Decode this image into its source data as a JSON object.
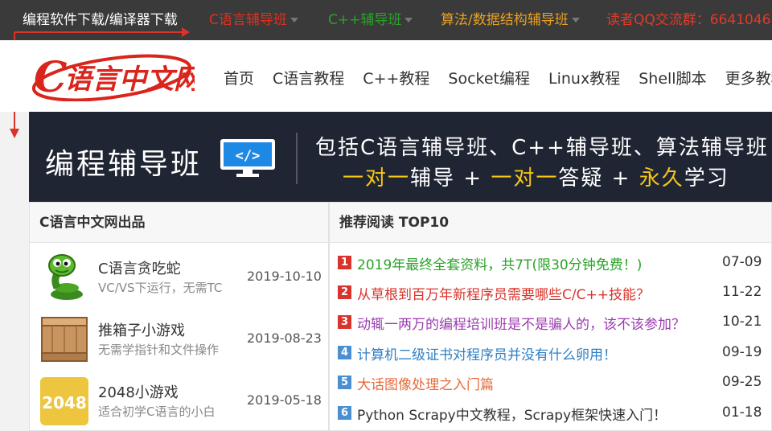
{
  "topbar": {
    "items": [
      {
        "label": "编程软件下载/编译器下载",
        "color": "#ffffff"
      },
      {
        "label": "C语言辅导班",
        "color": "#e0301e"
      },
      {
        "label": "C++辅导班",
        "color": "#2aa22a"
      },
      {
        "label": "算法/数据结构辅导班",
        "color": "#e8a020"
      },
      {
        "label": "读者QQ交流群：6641046",
        "color": "#e03a2a"
      }
    ]
  },
  "logo": {
    "text": "C语言中文网",
    "color": "#d9251c"
  },
  "nav": {
    "items": [
      "首页",
      "C语言教程",
      "C++教程",
      "Socket编程",
      "Linux教程",
      "Shell脚本",
      "更多教程»"
    ]
  },
  "banner": {
    "title": "编程辅导班",
    "icon_label": "</>",
    "line1": "包括C语言辅导班、C++辅导班、算法辅导班",
    "line2_parts": [
      "一对一",
      "辅导 + ",
      "一对一",
      "答疑 + ",
      "永久",
      "学习"
    ]
  },
  "left_panel": {
    "header": "C语言中文网出品",
    "items": [
      {
        "title": "C语言贪吃蛇",
        "desc": "VC/VS下运行，无需TC",
        "date": "2019-10-10",
        "icon": "snake-icon"
      },
      {
        "title": "推箱子小游戏",
        "desc": "无需学指针和文件操作",
        "date": "2019-08-23",
        "icon": "crate-icon"
      },
      {
        "title": "2048小游戏",
        "desc": "适合初学C语言的小白",
        "date": "2019-05-18",
        "icon": "2048-icon",
        "icon_text": "2048"
      }
    ]
  },
  "right_panel": {
    "header": "推荐阅读 TOP10",
    "items": [
      {
        "num": "1",
        "num_color": "#d9342b",
        "text": "2019年最终全套资料，共7T(限30分钟免费！)",
        "text_color": "#2aa22a",
        "date": "07-09"
      },
      {
        "num": "2",
        "num_color": "#d9342b",
        "text": "从草根到百万年新程序员需要哪些C/C++技能？",
        "text_color": "#d9342b",
        "date": "11-22"
      },
      {
        "num": "3",
        "num_color": "#d9342b",
        "text": "动辄一两万的编程培训班是不是骗人的，该不该参加？",
        "text_color": "#9b3bb0",
        "date": "10-21"
      },
      {
        "num": "4",
        "num_color": "#4a8fd0",
        "text": "计算机二级证书对程序员并没有什么卵用！",
        "text_color": "#2e7fc4",
        "date": "09-19"
      },
      {
        "num": "5",
        "num_color": "#4a8fd0",
        "text": "大话图像处理之入门篇",
        "text_color": "#e86a3a",
        "date": "09-25"
      },
      {
        "num": "6",
        "num_color": "#4a8fd0",
        "text": "Python Scrapy中文教程，Scrapy框架快速入门！",
        "text_color": "#333333",
        "date": "01-18"
      }
    ]
  }
}
